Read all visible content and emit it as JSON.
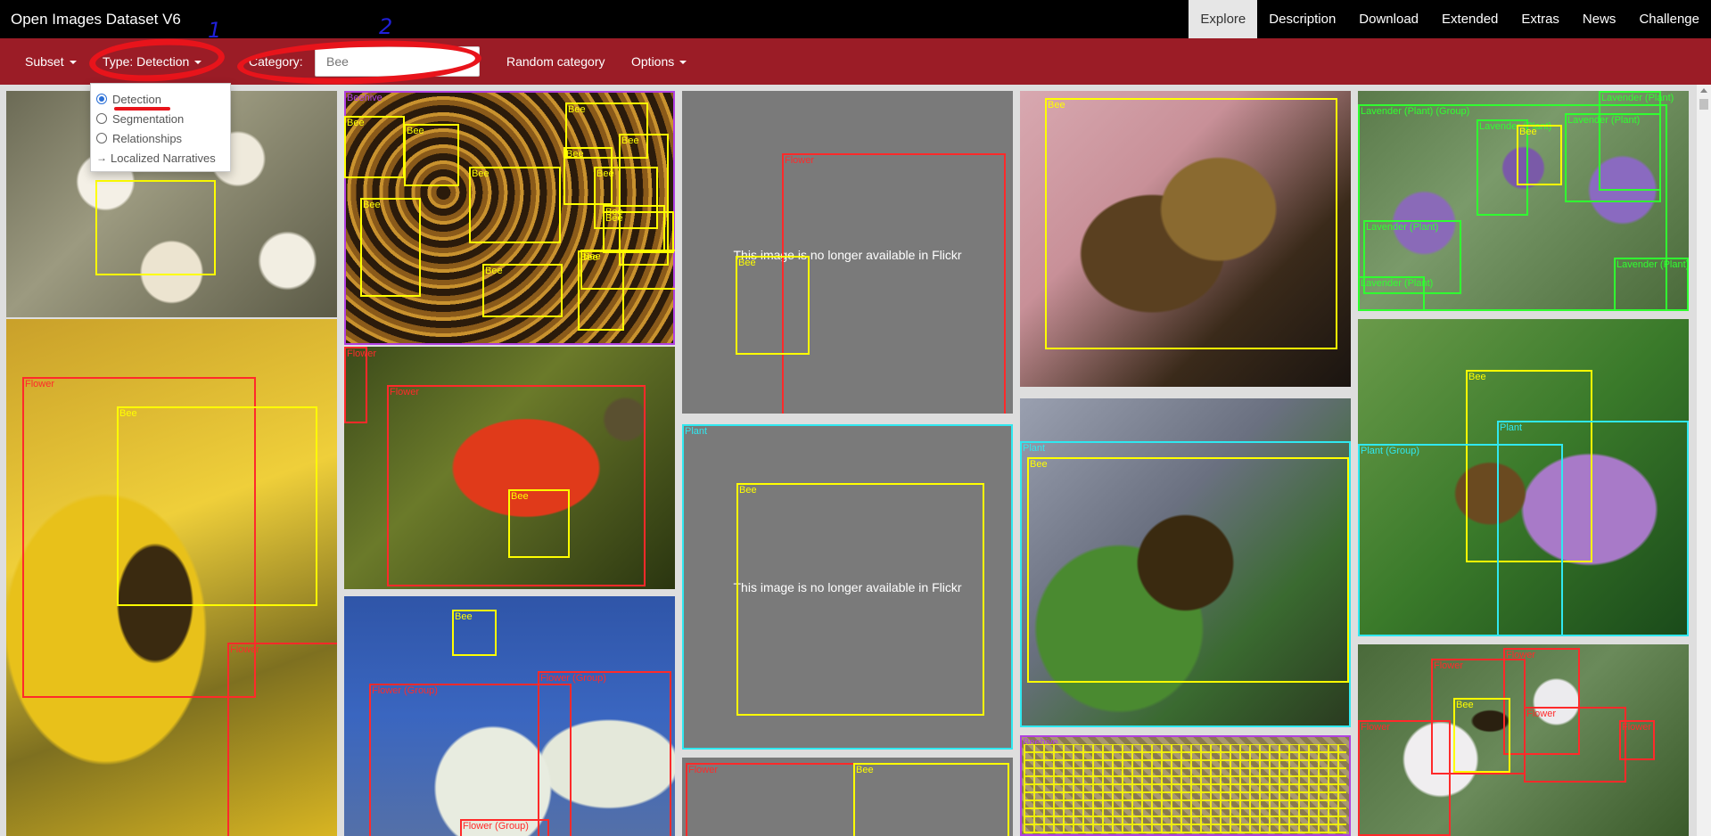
{
  "brand": "Open Images Dataset V6",
  "nav": [
    "Explore",
    "Description",
    "Download",
    "Extended",
    "Extras",
    "News",
    "Challenge"
  ],
  "toolbar": {
    "subset": "Subset",
    "type": "Type: Detection",
    "category_label": "Category:",
    "category_value": "Bee",
    "random": "Random category",
    "options": "Options"
  },
  "annotations": [
    "1",
    "2"
  ],
  "dropdown": {
    "items": [
      "Detection",
      "Segmentation",
      "Relationships",
      "Localized Narratives"
    ],
    "selected": "Detection"
  },
  "labels": {
    "bee": "Bee",
    "flower": "Flower",
    "plant": "Plant",
    "beehive": "Beehive",
    "lavender": "Lavender (Plant)",
    "lavender_group": "Lavender (Plant) (Group)",
    "plant_group": "Plant (Group)",
    "flower_group": "Flower (Group)"
  },
  "unavailable_text": "This image is no longer available in Flickr"
}
